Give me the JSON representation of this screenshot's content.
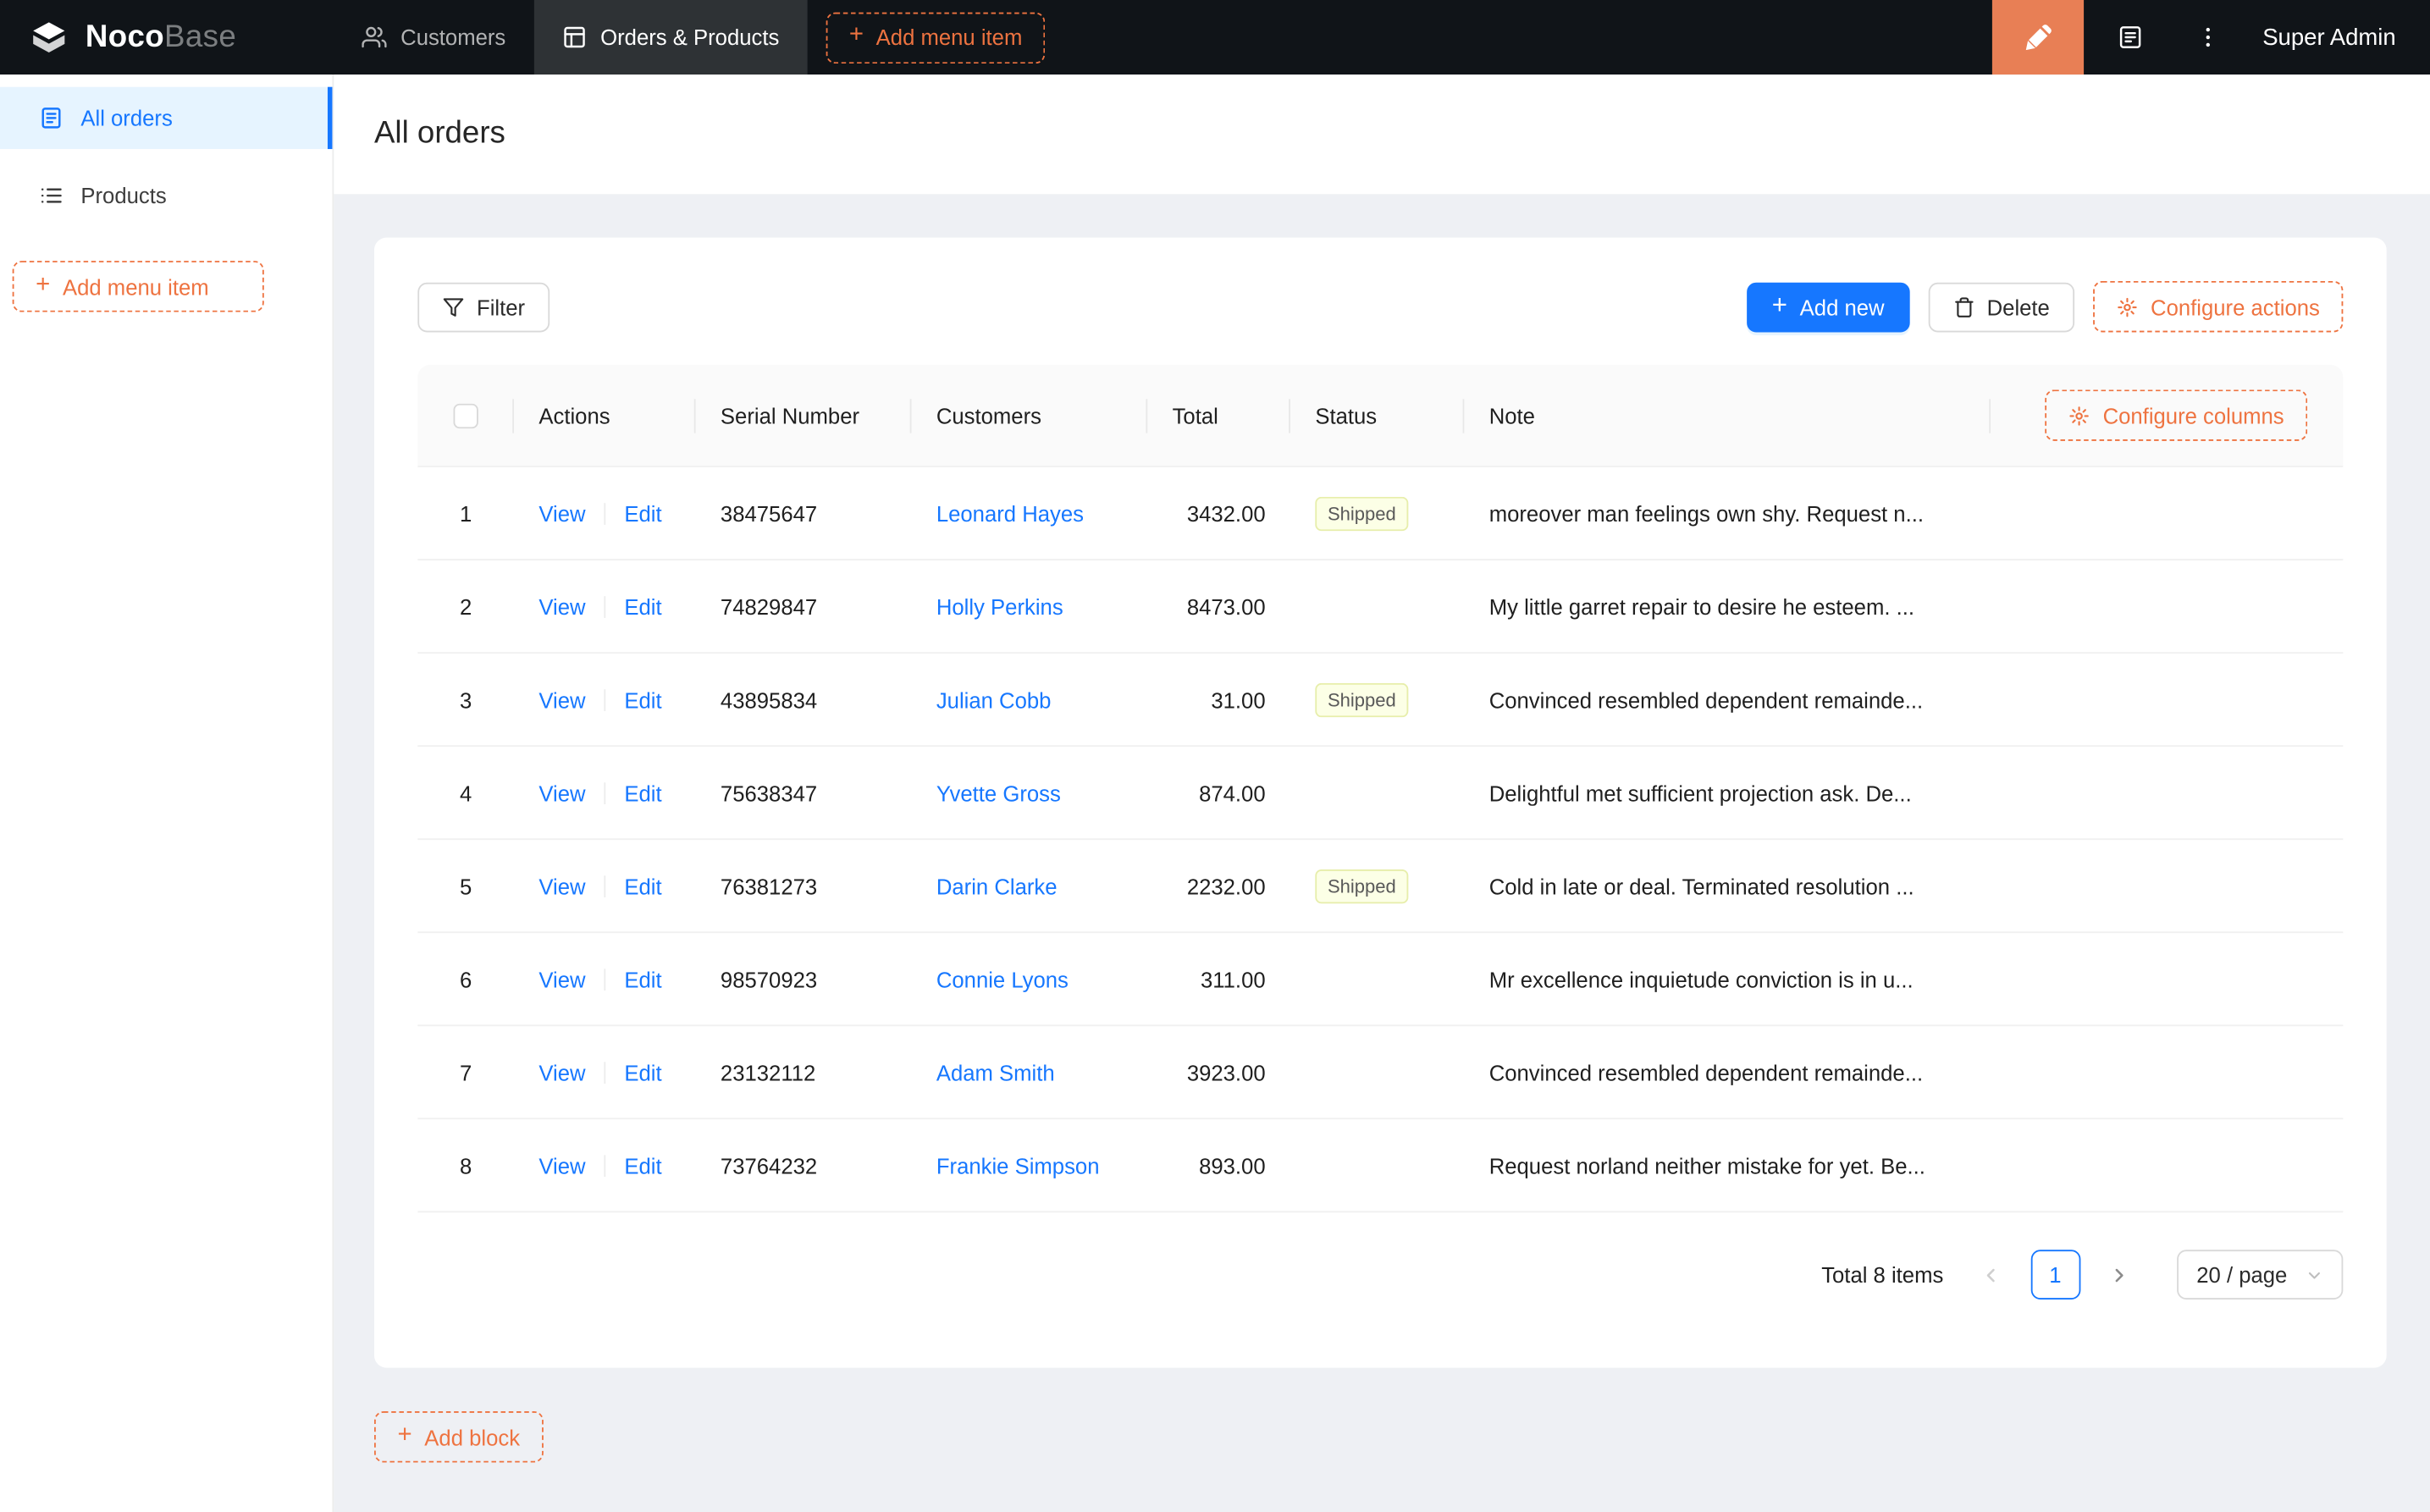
{
  "colors": {
    "primary": "#1677ff",
    "orange": "#ee7340",
    "header_bg": "#101418",
    "content_bg": "#eef0f4",
    "tag_bg": "#fcffe6",
    "tag_border": "#e7eeab"
  },
  "header": {
    "brand_bold": "Noco",
    "brand_light": "Base",
    "nav": [
      {
        "label": "Customers",
        "icon": "users-icon"
      },
      {
        "label": "Orders & Products",
        "icon": "table-icon",
        "active": true
      }
    ],
    "add_menu_item": "Add menu item",
    "user": "Super Admin"
  },
  "sidebar": {
    "items": [
      {
        "label": "All orders",
        "icon": "document-icon",
        "active": true
      },
      {
        "label": "Products",
        "icon": "list-icon",
        "active": false
      }
    ],
    "add_menu_item": "Add menu item"
  },
  "page": {
    "title": "All orders"
  },
  "toolbar": {
    "filter": "Filter",
    "add_new": "Add new",
    "delete": "Delete",
    "configure_actions": "Configure actions"
  },
  "table": {
    "configure_columns": "Configure columns",
    "columns": [
      "Actions",
      "Serial Number",
      "Customers",
      "Total",
      "Status",
      "Note"
    ],
    "action_labels": {
      "view": "View",
      "edit": "Edit"
    },
    "rows": [
      {
        "index": "1",
        "serial": "38475647",
        "customer": "Leonard Hayes",
        "total": "3432.00",
        "status": "Shipped",
        "note": "moreover man feelings own shy. Request n..."
      },
      {
        "index": "2",
        "serial": "74829847",
        "customer": "Holly Perkins",
        "total": "8473.00",
        "status": "",
        "note": "My little garret repair to desire he esteem. ..."
      },
      {
        "index": "3",
        "serial": "43895834",
        "customer": "Julian Cobb",
        "total": "31.00",
        "status": "Shipped",
        "note": "Convinced resembled dependent remainde..."
      },
      {
        "index": "4",
        "serial": "75638347",
        "customer": "Yvette Gross",
        "total": "874.00",
        "status": "",
        "note": "Delightful met sufficient projection ask. De..."
      },
      {
        "index": "5",
        "serial": "76381273",
        "customer": "Darin Clarke",
        "total": "2232.00",
        "status": "Shipped",
        "note": "Cold in late or deal. Terminated resolution ..."
      },
      {
        "index": "6",
        "serial": "98570923",
        "customer": "Connie Lyons",
        "total": "311.00",
        "status": "",
        "note": "Mr excellence inquietude conviction is in u..."
      },
      {
        "index": "7",
        "serial": "23132112",
        "customer": "Adam Smith",
        "total": "3923.00",
        "status": "",
        "note": "Convinced resembled dependent remainde..."
      },
      {
        "index": "8",
        "serial": "73764232",
        "customer": "Frankie Simpson",
        "total": "893.00",
        "status": "",
        "note": "Request norland neither mistake for yet. Be..."
      }
    ],
    "pagination": {
      "total_text": "Total 8 items",
      "current_page": "1",
      "page_size": "20 / page"
    }
  },
  "footer": {
    "add_block": "Add block"
  }
}
